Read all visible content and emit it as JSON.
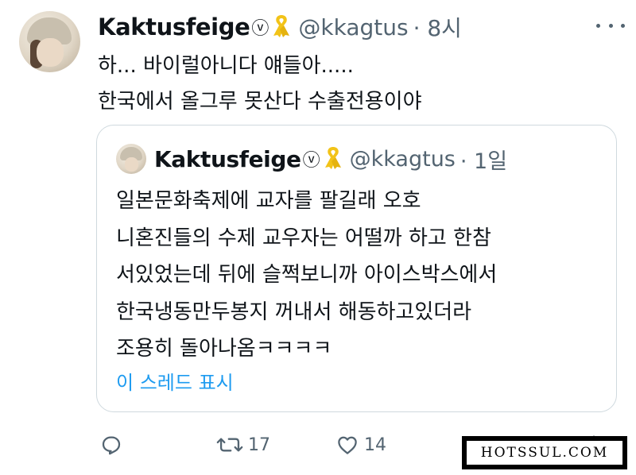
{
  "tweet": {
    "author_name": "Kaktusfeige",
    "author_mark": "ⓥ",
    "handle": "@kkagtus",
    "time": "· 8시",
    "text_lines": [
      "하... 바이럴아니다 얘들아.....",
      "한국에서 올그루 못산다 수출전용이야"
    ]
  },
  "quote": {
    "author_name": "Kaktusfeige",
    "author_mark": "ⓥ",
    "handle": "@kkagtus",
    "time": "· 1일",
    "text_lines": [
      "일본문화축제에 교자를 팔길래 오호",
      "니혼진들의 수제 교우자는 어떨까 하고 한참",
      "서있었는데 뒤에 슬쩍보니까 아이스박스에서",
      "한국냉동만두봉지 꺼내서 해동하고있더라",
      "조용히 돌아나옴ㅋㅋㅋㅋ"
    ],
    "thread_link": "이 스레드 표시"
  },
  "actions": {
    "retweets": "17",
    "likes": "14"
  },
  "watermark": "HOTSSUL.COM",
  "colors": {
    "text": "#0f1419",
    "muted": "#536471",
    "link": "#1d9bf0",
    "ribbon": "#f2c318",
    "border": "#cfd9de"
  },
  "icons": [
    "reply-icon",
    "retweet-icon",
    "like-icon",
    "share-icon",
    "more-icon",
    "yellow-ribbon-icon"
  ]
}
